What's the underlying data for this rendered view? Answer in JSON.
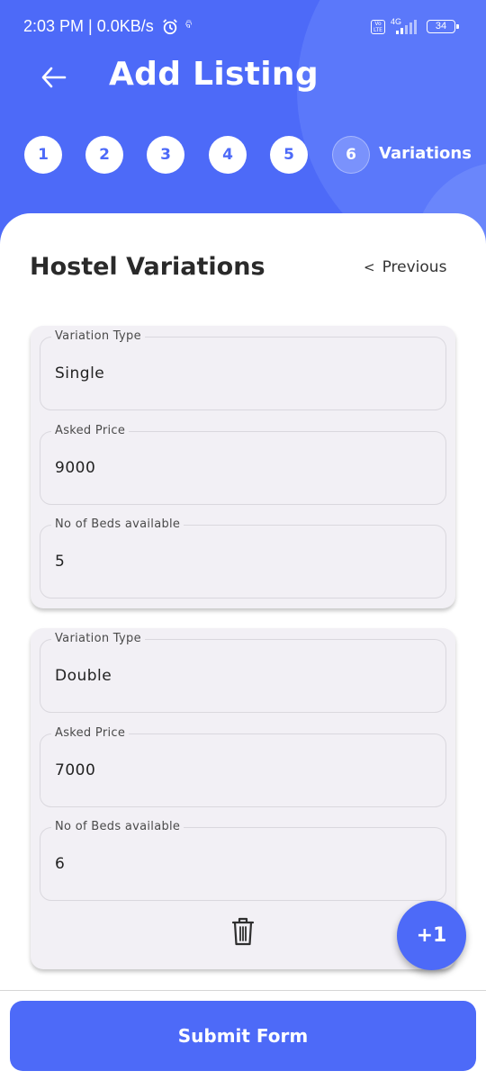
{
  "status_bar": {
    "time_speed": "2:03 PM | 0.0KB/s",
    "extra": "ବି",
    "volte": "Vo LTE",
    "network": "4G",
    "battery": "34"
  },
  "header": {
    "title": "Add Listing",
    "steps": [
      "1",
      "2",
      "3",
      "4",
      "5",
      "6"
    ],
    "active_step_label": "Variations"
  },
  "section": {
    "title": "Hostel Variations",
    "previous_label": "Previous"
  },
  "variations": [
    {
      "variation_type_label": "Variation Type",
      "variation_type": "Single",
      "asked_price_label": "Asked Price",
      "asked_price": "9000",
      "beds_label": "No of Beds available",
      "beds": "5"
    },
    {
      "variation_type_label": "Variation Type",
      "variation_type": "Double",
      "asked_price_label": "Asked Price",
      "asked_price": "7000",
      "beds_label": "No of Beds available",
      "beds": "6"
    }
  ],
  "fab_label": "+1",
  "submit_label": "Submit Form",
  "colors": {
    "primary": "#4d6af8",
    "card_bg": "#f2f0f5",
    "text": "#2a2a2a"
  }
}
